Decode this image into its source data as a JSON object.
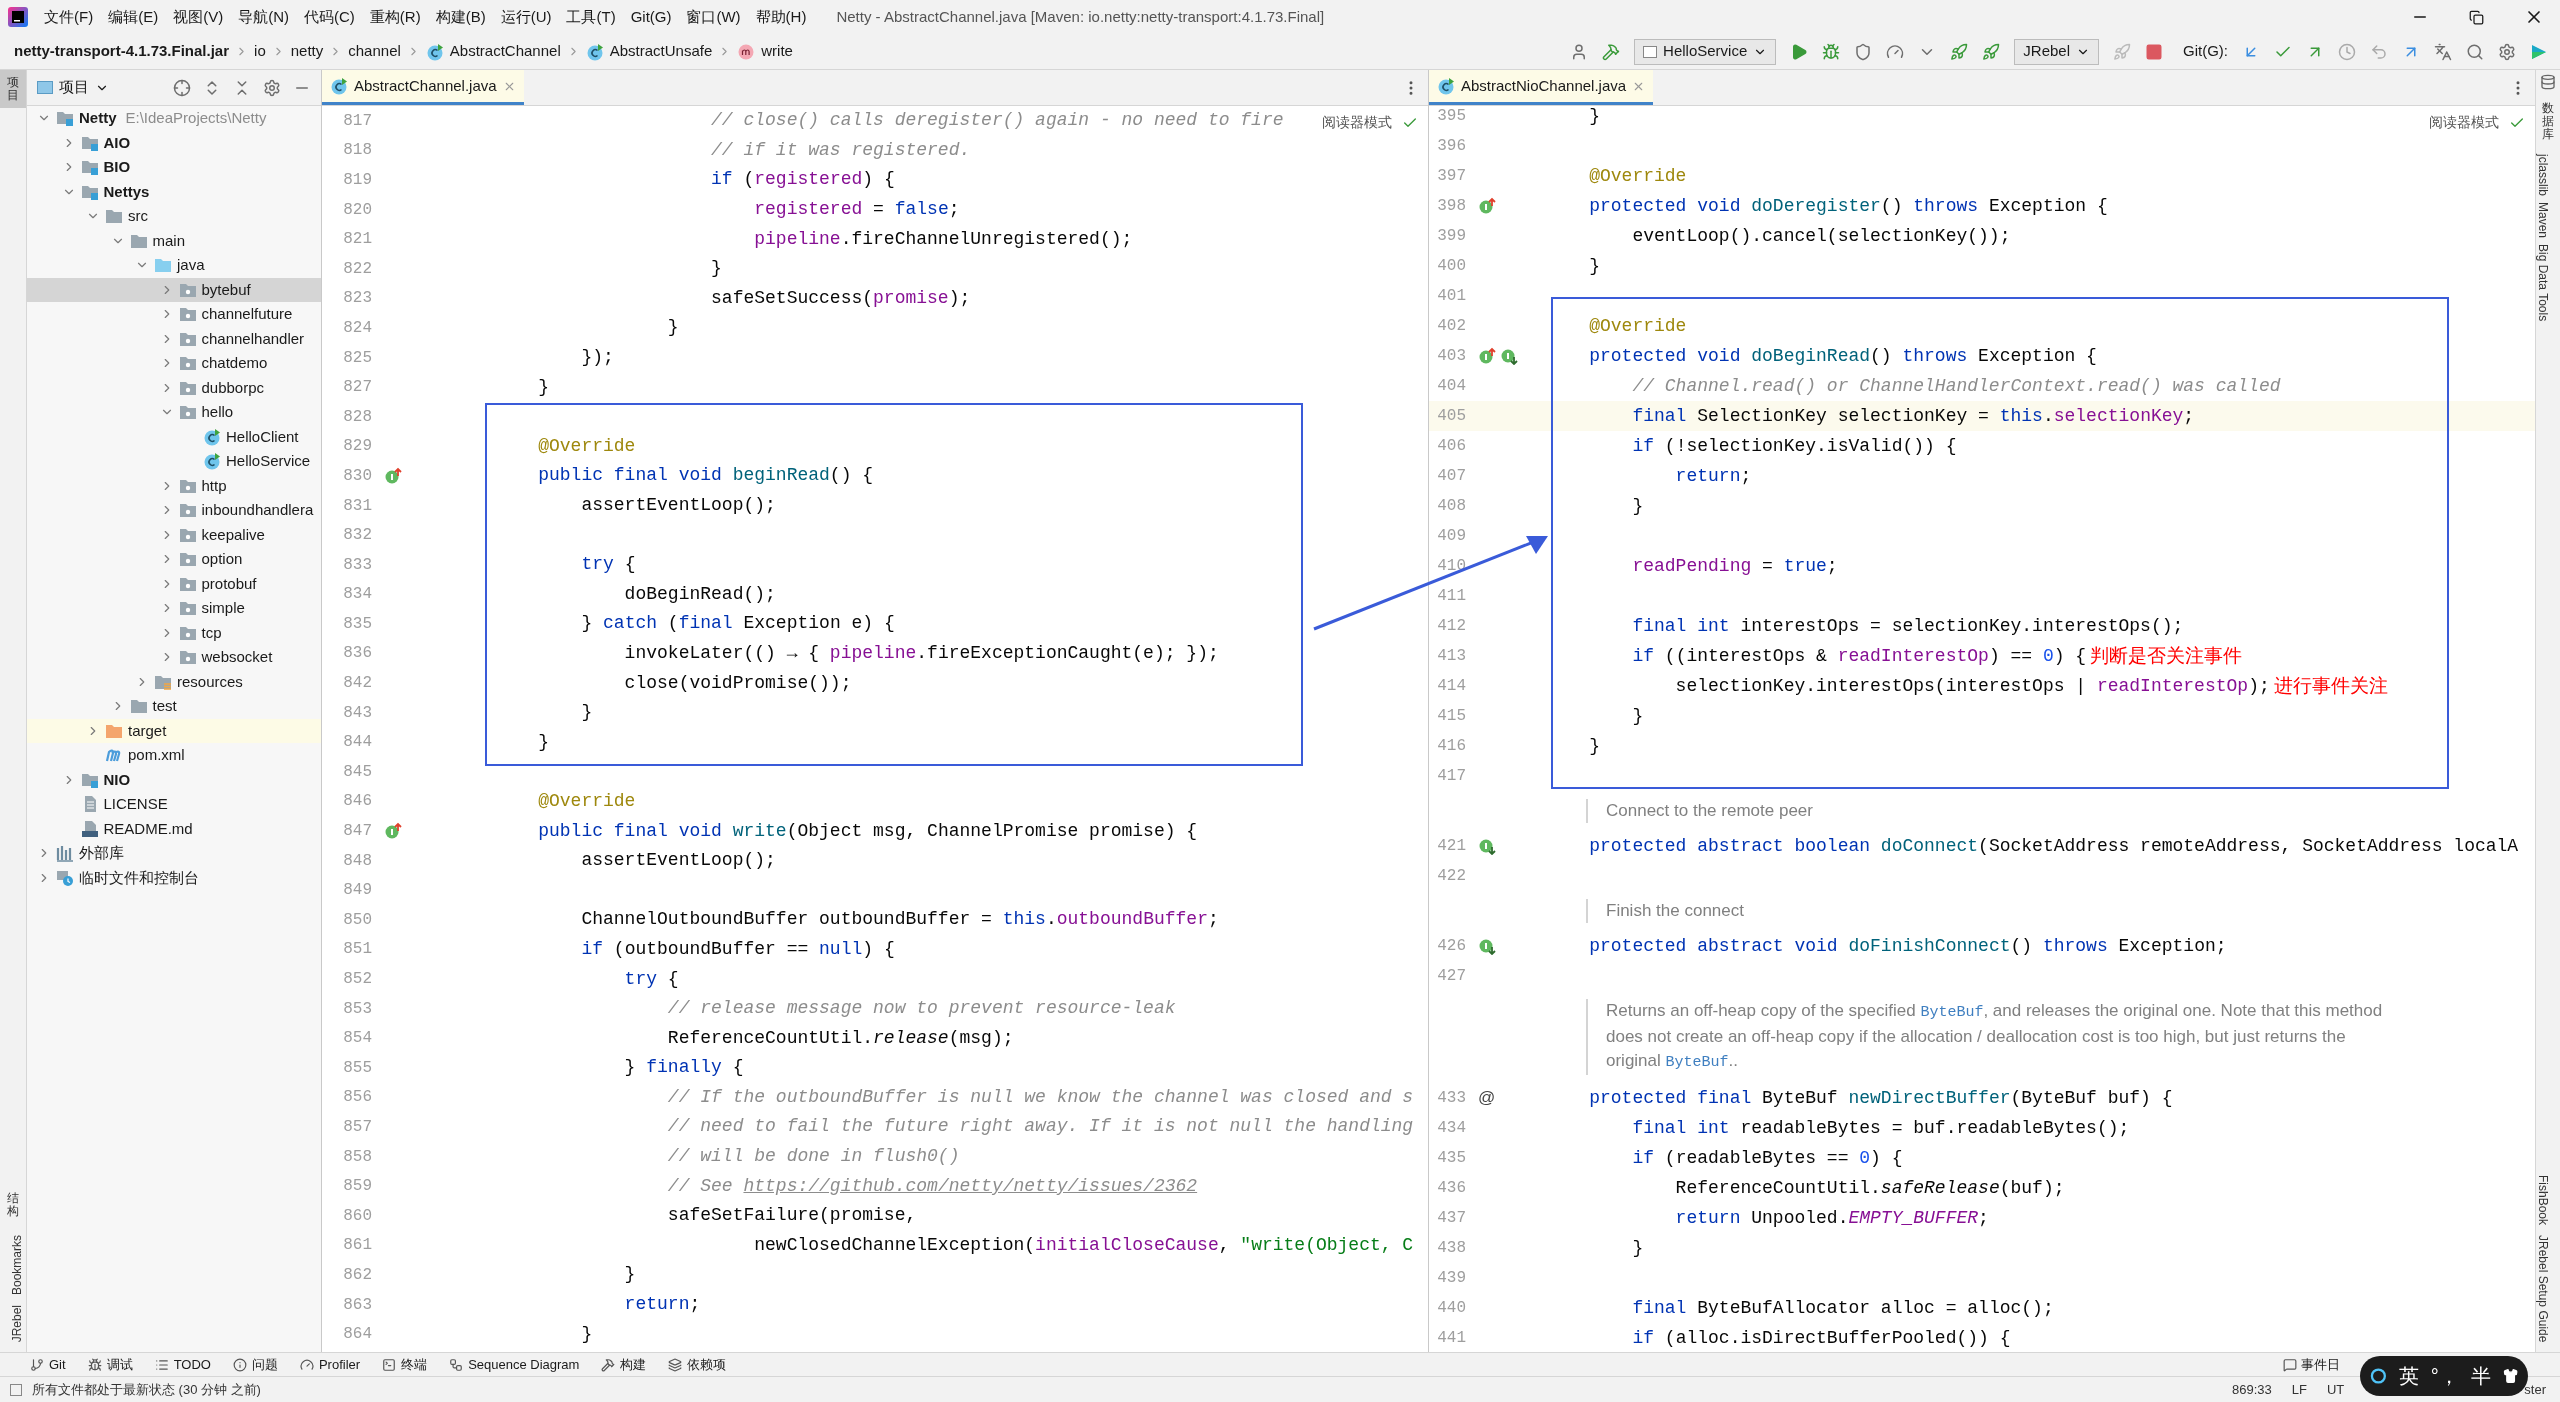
{
  "window": {
    "title": "Netty - AbstractChannel.java [Maven: io.netty:netty-transport:4.1.73.Final]",
    "menu": [
      "文件(F)",
      "编辑(E)",
      "视图(V)",
      "导航(N)",
      "代码(C)",
      "重构(R)",
      "构建(B)",
      "运行(U)",
      "工具(T)",
      "Git(G)",
      "窗口(W)",
      "帮助(H)"
    ]
  },
  "breadcrumbs": [
    {
      "label": "netty-transport-4.1.73.Final.jar",
      "kind": "jar"
    },
    {
      "label": "io",
      "kind": "package"
    },
    {
      "label": "netty",
      "kind": "package"
    },
    {
      "label": "channel",
      "kind": "package"
    },
    {
      "label": "AbstractChannel",
      "kind": "class"
    },
    {
      "label": "AbstractUnsafe",
      "kind": "class"
    },
    {
      "label": "write",
      "kind": "method"
    }
  ],
  "toolbar": {
    "run_config": "HelloService",
    "jrebel": "JRebel",
    "git_label": "Git(G):"
  },
  "left_strip": {
    "top": [
      {
        "label": "项目",
        "kind": "cjk",
        "selected": true
      }
    ],
    "bottom": [
      {
        "label": "结构",
        "kind": "cjk",
        "selected": false
      },
      {
        "label": "Bookmarks",
        "kind": "latin",
        "selected": false
      },
      {
        "label": "JRebel",
        "kind": "latin",
        "selected": false
      }
    ]
  },
  "right_strip": {
    "top": [
      {
        "label": "数据库",
        "kind": "cjk",
        "selected": false
      },
      {
        "label": "jclasslib",
        "kind": "latin",
        "selected": false
      },
      {
        "label": "Maven",
        "kind": "latin",
        "selected": false
      },
      {
        "label": "Big Data Tools",
        "kind": "latin",
        "selected": false
      }
    ],
    "bottom": [
      {
        "label": "FishBook",
        "kind": "latin",
        "selected": false
      },
      {
        "label": "JRebel Setup Guide",
        "kind": "latin",
        "selected": false
      }
    ]
  },
  "project": {
    "title": "项目",
    "tree": [
      {
        "label": "Netty",
        "path": "E:\\IdeaProjects\\Netty",
        "kind": "module",
        "expanded": true,
        "selected": false,
        "children": [
          {
            "label": "AIO",
            "kind": "module",
            "expanded": false,
            "selected": false
          },
          {
            "label": "BIO",
            "kind": "module",
            "expanded": false,
            "selected": false
          },
          {
            "label": "Nettys",
            "kind": "module",
            "expanded": true,
            "selected": false,
            "children": [
              {
                "label": "src",
                "kind": "folder",
                "expanded": true,
                "selected": false,
                "children": [
                  {
                    "label": "main",
                    "kind": "folder",
                    "expanded": true,
                    "selected": false,
                    "children": [
                      {
                        "label": "java",
                        "kind": "sources",
                        "expanded": true,
                        "selected": false,
                        "children": [
                          {
                            "label": "bytebuf",
                            "kind": "package",
                            "expanded": false,
                            "selected": true
                          },
                          {
                            "label": "channelfuture",
                            "kind": "package",
                            "expanded": false,
                            "selected": false
                          },
                          {
                            "label": "channelhandler",
                            "kind": "package",
                            "expanded": false,
                            "selected": false
                          },
                          {
                            "label": "chatdemo",
                            "kind": "package",
                            "expanded": false,
                            "selected": false
                          },
                          {
                            "label": "dubborpc",
                            "kind": "package",
                            "expanded": false,
                            "selected": false
                          },
                          {
                            "label": "hello",
                            "kind": "package",
                            "expanded": true,
                            "selected": false,
                            "children": [
                              {
                                "label": "HelloClient",
                                "kind": "class",
                                "selected": false
                              },
                              {
                                "label": "HelloService",
                                "kind": "class",
                                "selected": false
                              }
                            ]
                          },
                          {
                            "label": "http",
                            "kind": "package",
                            "expanded": false,
                            "selected": false
                          },
                          {
                            "label": "inboundhandlera",
                            "kind": "package",
                            "expanded": false,
                            "selected": false
                          },
                          {
                            "label": "keepalive",
                            "kind": "package",
                            "expanded": false,
                            "selected": false
                          },
                          {
                            "label": "option",
                            "kind": "package",
                            "expanded": false,
                            "selected": false
                          },
                          {
                            "label": "protobuf",
                            "kind": "package",
                            "expanded": false,
                            "selected": false
                          },
                          {
                            "label": "simple",
                            "kind": "package",
                            "expanded": false,
                            "selected": false
                          },
                          {
                            "label": "tcp",
                            "kind": "package",
                            "expanded": false,
                            "selected": false
                          },
                          {
                            "label": "websocket",
                            "kind": "package",
                            "expanded": false,
                            "selected": false
                          }
                        ]
                      },
                      {
                        "label": "resources",
                        "kind": "resources",
                        "expanded": false,
                        "selected": false
                      }
                    ]
                  },
                  {
                    "label": "test",
                    "kind": "folder",
                    "expanded": false,
                    "selected": false
                  }
                ]
              },
              {
                "label": "target",
                "kind": "excluded",
                "expanded": false,
                "selected": false
              },
              {
                "label": "pom.xml",
                "kind": "maven",
                "selected": false
              }
            ]
          },
          {
            "label": "NIO",
            "kind": "module",
            "expanded": false,
            "selected": false
          },
          {
            "label": "LICENSE",
            "kind": "file",
            "selected": false
          },
          {
            "label": "README.md",
            "kind": "markdown",
            "selected": false
          }
        ]
      },
      {
        "label": "外部库",
        "kind": "library",
        "expanded": false,
        "selected": false
      },
      {
        "label": "临时文件和控制台",
        "kind": "scratch",
        "expanded": false,
        "selected": false
      }
    ]
  },
  "editors": [
    {
      "tab": {
        "label": "AbstractChannel.java",
        "selected": true
      },
      "reader_mode": "阅读器模式",
      "lines": [
        {
          "kind": "code",
          "n": "817",
          "t": [
            {
              "kind": "comment",
              "text": "                    // close() calls deregister() again - no need to fire"
            }
          ]
        },
        {
          "kind": "code",
          "n": "818",
          "t": [
            {
              "kind": "comment",
              "text": "                    // if it was registered."
            }
          ]
        },
        {
          "kind": "code",
          "n": "819",
          "t": [
            {
              "kind": "keyword",
              "text": "                    if "
            },
            {
              "kind": "plain",
              "text": "("
            },
            {
              "kind": "field",
              "text": "registered"
            },
            {
              "kind": "plain",
              "text": ") {"
            }
          ]
        },
        {
          "kind": "code",
          "n": "820",
          "t": [
            {
              "kind": "field",
              "text": "                        registered"
            },
            {
              "kind": "plain",
              "text": " = "
            },
            {
              "kind": "keyword",
              "text": "false"
            },
            {
              "kind": "plain",
              "text": ";"
            }
          ]
        },
        {
          "kind": "code",
          "n": "821",
          "t": [
            {
              "kind": "field",
              "text": "                        pipeline"
            },
            {
              "kind": "plain",
              "text": ".fireChannelUnregistered();"
            }
          ]
        },
        {
          "kind": "code",
          "n": "822",
          "t": [
            {
              "kind": "plain",
              "text": "                    }"
            }
          ]
        },
        {
          "kind": "code",
          "n": "823",
          "t": [
            {
              "kind": "plain",
              "text": "                    safeSetSuccess("
            },
            {
              "kind": "field",
              "text": "promise"
            },
            {
              "kind": "plain",
              "text": ");"
            }
          ]
        },
        {
          "kind": "code",
          "n": "824",
          "t": [
            {
              "kind": "plain",
              "text": "                }"
            }
          ]
        },
        {
          "kind": "code",
          "n": "825",
          "t": [
            {
              "kind": "plain",
              "text": "        });"
            }
          ]
        },
        {
          "kind": "code",
          "n": "827",
          "t": [
            {
              "kind": "plain",
              "text": "    }"
            }
          ]
        },
        {
          "kind": "code",
          "n": "828"
        },
        {
          "kind": "code",
          "n": "829",
          "t": [
            {
              "kind": "annotation",
              "text": "    @Override"
            }
          ]
        },
        {
          "kind": "code",
          "n": "830",
          "t": [
            {
              "kind": "keyword",
              "text": "    public final void "
            },
            {
              "kind": "method",
              "text": "beginRead"
            },
            {
              "kind": "plain",
              "text": "() {"
            }
          ],
          "markers": [
            {
              "kind": "override"
            }
          ]
        },
        {
          "kind": "code",
          "n": "831",
          "t": [
            {
              "kind": "plain",
              "text": "        assertEventLoop();"
            }
          ]
        },
        {
          "kind": "code",
          "n": "832"
        },
        {
          "kind": "code",
          "n": "833",
          "t": [
            {
              "kind": "keyword",
              "text": "        try "
            },
            {
              "kind": "plain",
              "text": "{"
            }
          ]
        },
        {
          "kind": "code",
          "n": "834",
          "t": [
            {
              "kind": "plain",
              "text": "            doBeginRead();"
            }
          ]
        },
        {
          "kind": "code",
          "n": "835",
          "t": [
            {
              "kind": "plain",
              "text": "        } "
            },
            {
              "kind": "keyword",
              "text": "catch "
            },
            {
              "kind": "plain",
              "text": "("
            },
            {
              "kind": "keyword",
              "text": "final "
            },
            {
              "kind": "plain",
              "text": "Exception e) {"
            }
          ]
        },
        {
          "kind": "code",
          "n": "836",
          "t": [
            {
              "kind": "plain",
              "text": "            invokeLater(() → { "
            },
            {
              "kind": "field",
              "text": "pipeline"
            },
            {
              "kind": "plain",
              "text": ".fireExceptionCaught(e); });"
            }
          ]
        },
        {
          "kind": "code",
          "n": "842",
          "t": [
            {
              "kind": "plain",
              "text": "            close(voidPromise());"
            }
          ]
        },
        {
          "kind": "code",
          "n": "843",
          "t": [
            {
              "kind": "plain",
              "text": "        }"
            }
          ]
        },
        {
          "kind": "code",
          "n": "844",
          "t": [
            {
              "kind": "plain",
              "text": "    }"
            }
          ]
        },
        {
          "kind": "code",
          "n": "845"
        },
        {
          "kind": "code",
          "n": "846",
          "t": [
            {
              "kind": "annotation",
              "text": "    @Override"
            }
          ]
        },
        {
          "kind": "code",
          "n": "847",
          "t": [
            {
              "kind": "keyword",
              "text": "    public final void "
            },
            {
              "kind": "method",
              "text": "write"
            },
            {
              "kind": "plain",
              "text": "(Object msg, ChannelPromise promise) {"
            }
          ],
          "markers": [
            {
              "kind": "override"
            }
          ]
        },
        {
          "kind": "code",
          "n": "848",
          "t": [
            {
              "kind": "plain",
              "text": "        assertEventLoop();"
            }
          ]
        },
        {
          "kind": "code",
          "n": "849"
        },
        {
          "kind": "code",
          "n": "850",
          "t": [
            {
              "kind": "plain",
              "text": "        ChannelOutboundBuffer outboundBuffer = "
            },
            {
              "kind": "keyword",
              "text": "this"
            },
            {
              "kind": "plain",
              "text": "."
            },
            {
              "kind": "field",
              "text": "outboundBuffer"
            },
            {
              "kind": "plain",
              "text": ";"
            }
          ]
        },
        {
          "kind": "code",
          "n": "851",
          "t": [
            {
              "kind": "keyword",
              "text": "        if "
            },
            {
              "kind": "plain",
              "text": "(outboundBuffer == "
            },
            {
              "kind": "keyword",
              "text": "null"
            },
            {
              "kind": "plain",
              "text": ") {"
            }
          ]
        },
        {
          "kind": "code",
          "n": "852",
          "t": [
            {
              "kind": "keyword",
              "text": "            try "
            },
            {
              "kind": "plain",
              "text": "{"
            }
          ]
        },
        {
          "kind": "code",
          "n": "853",
          "t": [
            {
              "kind": "comment",
              "text": "                // release message now to prevent resource-leak"
            }
          ]
        },
        {
          "kind": "code",
          "n": "854",
          "t": [
            {
              "kind": "plain",
              "text": "                ReferenceCountUtil."
            },
            {
              "kind": "static",
              "text": "release"
            },
            {
              "kind": "plain",
              "text": "(msg);"
            }
          ]
        },
        {
          "kind": "code",
          "n": "855",
          "t": [
            {
              "kind": "plain",
              "text": "            } "
            },
            {
              "kind": "keyword",
              "text": "finally "
            },
            {
              "kind": "plain",
              "text": "{"
            }
          ]
        },
        {
          "kind": "code",
          "n": "856",
          "t": [
            {
              "kind": "comment",
              "text": "                // If the outboundBuffer is null we know the channel was closed and s"
            }
          ]
        },
        {
          "kind": "code",
          "n": "857",
          "t": [
            {
              "kind": "comment",
              "text": "                // need to fail the future right away. If it is not null the handling"
            }
          ]
        },
        {
          "kind": "code",
          "n": "858",
          "t": [
            {
              "kind": "comment",
              "text": "                // will be done in flush0()"
            }
          ]
        },
        {
          "kind": "code",
          "n": "859",
          "t": [
            {
              "kind": "comment",
              "text": "                // See "
            },
            {
              "kind": "link",
              "text": "https://github.com/netty/netty/issues/2362"
            }
          ]
        },
        {
          "kind": "code",
          "n": "860",
          "t": [
            {
              "kind": "plain",
              "text": "                safeSetFailure(promise,"
            }
          ]
        },
        {
          "kind": "code",
          "n": "861",
          "t": [
            {
              "kind": "plain",
              "text": "                        newClosedChannelException("
            },
            {
              "kind": "field",
              "text": "initialCloseCause"
            },
            {
              "kind": "plain",
              "text": ", "
            },
            {
              "kind": "string",
              "text": "\"write(Object, C"
            }
          ]
        },
        {
          "kind": "code",
          "n": "862",
          "t": [
            {
              "kind": "plain",
              "text": "            }"
            }
          ]
        },
        {
          "kind": "code",
          "n": "863",
          "t": [
            {
              "kind": "keyword",
              "text": "            return"
            },
            {
              "kind": "plain",
              "text": ";"
            }
          ]
        },
        {
          "kind": "code",
          "n": "864",
          "t": [
            {
              "kind": "plain",
              "text": "        }"
            }
          ]
        }
      ]
    },
    {
      "tab": {
        "label": "AbstractNioChannel.java",
        "selected": true
      },
      "reader_mode": "阅读器模式",
      "lines": [
        {
          "kind": "code",
          "n": "395",
          "t": [
            {
              "kind": "plain",
              "text": "    }"
            }
          ]
        },
        {
          "kind": "code",
          "n": "396"
        },
        {
          "kind": "code",
          "n": "397",
          "t": [
            {
              "kind": "annotation",
              "text": "    @Override"
            }
          ]
        },
        {
          "kind": "code",
          "n": "398",
          "t": [
            {
              "kind": "keyword",
              "text": "    protected void "
            },
            {
              "kind": "method",
              "text": "doDeregister"
            },
            {
              "kind": "plain",
              "text": "() "
            },
            {
              "kind": "keyword",
              "text": "throws "
            },
            {
              "kind": "plain",
              "text": "Exception {"
            }
          ],
          "markers": [
            {
              "kind": "override"
            }
          ]
        },
        {
          "kind": "code",
          "n": "399",
          "t": [
            {
              "kind": "plain",
              "text": "        eventLoop().cancel(selectionKey());"
            }
          ]
        },
        {
          "kind": "code",
          "n": "400",
          "t": [
            {
              "kind": "plain",
              "text": "    }"
            }
          ]
        },
        {
          "kind": "code",
          "n": "401"
        },
        {
          "kind": "code",
          "n": "402",
          "t": [
            {
              "kind": "annotation",
              "text": "    @Override"
            }
          ]
        },
        {
          "kind": "code",
          "n": "403",
          "t": [
            {
              "kind": "keyword",
              "text": "    protected void "
            },
            {
              "kind": "method",
              "text": "doBeginRead"
            },
            {
              "kind": "plain",
              "text": "() "
            },
            {
              "kind": "keyword",
              "text": "throws "
            },
            {
              "kind": "plain",
              "text": "Exception {"
            }
          ],
          "markers": [
            {
              "kind": "override"
            },
            {
              "kind": "implemented"
            }
          ]
        },
        {
          "kind": "code",
          "n": "404",
          "t": [
            {
              "kind": "comment",
              "text": "        // Channel.read() or ChannelHandlerContext.read() was called"
            }
          ]
        },
        {
          "kind": "code",
          "n": "405",
          "current": true,
          "t": [
            {
              "kind": "keyword",
              "text": "        final "
            },
            {
              "kind": "plain",
              "text": "SelectionKey selectionKey = "
            },
            {
              "kind": "keyword",
              "text": "this"
            },
            {
              "kind": "plain",
              "text": "."
            },
            {
              "kind": "field",
              "text": "selectionKey"
            },
            {
              "kind": "plain",
              "text": ";"
            }
          ]
        },
        {
          "kind": "code",
          "n": "406",
          "t": [
            {
              "kind": "keyword",
              "text": "        if "
            },
            {
              "kind": "plain",
              "text": "(!selectionKey.isValid()) {"
            }
          ]
        },
        {
          "kind": "code",
          "n": "407",
          "t": [
            {
              "kind": "keyword",
              "text": "            return"
            },
            {
              "kind": "plain",
              "text": ";"
            }
          ]
        },
        {
          "kind": "code",
          "n": "408",
          "t": [
            {
              "kind": "plain",
              "text": "        }"
            }
          ]
        },
        {
          "kind": "code",
          "n": "409"
        },
        {
          "kind": "code",
          "n": "410",
          "t": [
            {
              "kind": "field",
              "text": "        readPending"
            },
            {
              "kind": "plain",
              "text": " = "
            },
            {
              "kind": "keyword",
              "text": "true"
            },
            {
              "kind": "plain",
              "text": ";"
            }
          ]
        },
        {
          "kind": "code",
          "n": "411"
        },
        {
          "kind": "code",
          "n": "412",
          "t": [
            {
              "kind": "keyword",
              "text": "        final int "
            },
            {
              "kind": "plain",
              "text": "interestOps = selectionKey.interestOps();"
            }
          ]
        },
        {
          "kind": "code",
          "n": "413",
          "t": [
            {
              "kind": "keyword",
              "text": "        if "
            },
            {
              "kind": "plain",
              "text": "((interestOps & "
            },
            {
              "kind": "field",
              "text": "readInterestOp"
            },
            {
              "kind": "plain",
              "text": ") == "
            },
            {
              "kind": "number",
              "text": "0"
            },
            {
              "kind": "plain",
              "text": ") {"
            }
          ],
          "note": "判断是否关注事件"
        },
        {
          "kind": "code",
          "n": "414",
          "t": [
            {
              "kind": "plain",
              "text": "            selectionKey.interestOps(interestOps | "
            },
            {
              "kind": "field",
              "text": "readInterestOp"
            },
            {
              "kind": "plain",
              "text": ");"
            }
          ],
          "note": "进行事件关注"
        },
        {
          "kind": "code",
          "n": "415",
          "t": [
            {
              "kind": "plain",
              "text": "        }"
            }
          ]
        },
        {
          "kind": "code",
          "n": "416",
          "t": [
            {
              "kind": "plain",
              "text": "    }"
            }
          ]
        },
        {
          "kind": "code",
          "n": "417"
        },
        {
          "kind": "doc",
          "t": [
            {
              "kind": "text",
              "text": "Connect to the remote peer"
            }
          ]
        },
        {
          "kind": "code",
          "n": "421",
          "t": [
            {
              "kind": "keyword",
              "text": "    protected abstract boolean "
            },
            {
              "kind": "method",
              "text": "doConnect"
            },
            {
              "kind": "plain",
              "text": "(SocketAddress remoteAddress, SocketAddress localA"
            }
          ],
          "markers": [
            {
              "kind": "implemented"
            }
          ]
        },
        {
          "kind": "code",
          "n": "422"
        },
        {
          "kind": "doc",
          "t": [
            {
              "kind": "text",
              "text": "Finish the connect"
            }
          ]
        },
        {
          "kind": "code",
          "n": "426",
          "t": [
            {
              "kind": "keyword",
              "text": "    protected abstract void "
            },
            {
              "kind": "method",
              "text": "doFinishConnect"
            },
            {
              "kind": "plain",
              "text": "() "
            },
            {
              "kind": "keyword",
              "text": "throws "
            },
            {
              "kind": "plain",
              "text": "Exception;"
            }
          ],
          "markers": [
            {
              "kind": "implemented"
            }
          ]
        },
        {
          "kind": "code",
          "n": "427"
        },
        {
          "kind": "doc",
          "t": [
            {
              "kind": "text",
              "text": "Returns an off-heap copy of the specified "
            },
            {
              "kind": "code",
              "text": "ByteBuf"
            },
            {
              "kind": "text",
              "text": ", and releases the original one. Note that this method does not create an off-heap copy if the allocation / deallocation cost is too high, but just returns the original "
            },
            {
              "kind": "code",
              "text": "ByteBuf"
            },
            {
              "kind": "text",
              "text": ".."
            }
          ]
        },
        {
          "kind": "code",
          "n": "433",
          "gutter_text": "@",
          "t": [
            {
              "kind": "keyword",
              "text": "    protected final "
            },
            {
              "kind": "plain",
              "text": "ByteBuf "
            },
            {
              "kind": "method",
              "text": "newDirectBuffer"
            },
            {
              "kind": "plain",
              "text": "(ByteBuf buf) {"
            }
          ]
        },
        {
          "kind": "code",
          "n": "434",
          "t": [
            {
              "kind": "keyword",
              "text": "        final int "
            },
            {
              "kind": "plain",
              "text": "readableBytes = buf.readableBytes();"
            }
          ]
        },
        {
          "kind": "code",
          "n": "435",
          "t": [
            {
              "kind": "keyword",
              "text": "        if "
            },
            {
              "kind": "plain",
              "text": "(readableBytes == "
            },
            {
              "kind": "number",
              "text": "0"
            },
            {
              "kind": "plain",
              "text": ") {"
            }
          ]
        },
        {
          "kind": "code",
          "n": "436",
          "t": [
            {
              "kind": "plain",
              "text": "            ReferenceCountUtil."
            },
            {
              "kind": "static",
              "text": "safeRelease"
            },
            {
              "kind": "plain",
              "text": "(buf);"
            }
          ]
        },
        {
          "kind": "code",
          "n": "437",
          "t": [
            {
              "kind": "keyword",
              "text": "            return "
            },
            {
              "kind": "plain",
              "text": "Unpooled."
            },
            {
              "kind": "constant",
              "text": "EMPTY_BUFFER"
            },
            {
              "kind": "plain",
              "text": ";"
            }
          ]
        },
        {
          "kind": "code",
          "n": "438",
          "t": [
            {
              "kind": "plain",
              "text": "        }"
            }
          ]
        },
        {
          "kind": "code",
          "n": "439"
        },
        {
          "kind": "code",
          "n": "440",
          "t": [
            {
              "kind": "keyword",
              "text": "        final "
            },
            {
              "kind": "plain",
              "text": "ByteBufAllocator alloc = alloc();"
            }
          ]
        },
        {
          "kind": "code",
          "n": "441",
          "t": [
            {
              "kind": "keyword",
              "text": "        if "
            },
            {
              "kind": "plain",
              "text": "(alloc.isDirectBufferPooled()) {"
            }
          ]
        }
      ]
    }
  ],
  "bottom_tools": [
    {
      "label": "Git",
      "kind": "git"
    },
    {
      "label": "调试",
      "kind": "debug"
    },
    {
      "label": "TODO",
      "kind": "todo"
    },
    {
      "label": "问题",
      "kind": "problems"
    },
    {
      "label": "Profiler",
      "kind": "profiler"
    },
    {
      "label": "终端",
      "kind": "terminal"
    },
    {
      "label": "Sequence Diagram",
      "kind": "sequence"
    },
    {
      "label": "构建",
      "kind": "build"
    },
    {
      "label": "依赖项",
      "kind": "deps"
    }
  ],
  "event_log": "事件日",
  "status_bar": {
    "message": "所有文件都处于最新状态 (30 分钟 之前)",
    "position": "869:33",
    "line_separator": "LF",
    "encoding": "UT",
    "branch": "ster"
  },
  "ime": {
    "mode": "英",
    "punct": "°，",
    "width": "半"
  }
}
